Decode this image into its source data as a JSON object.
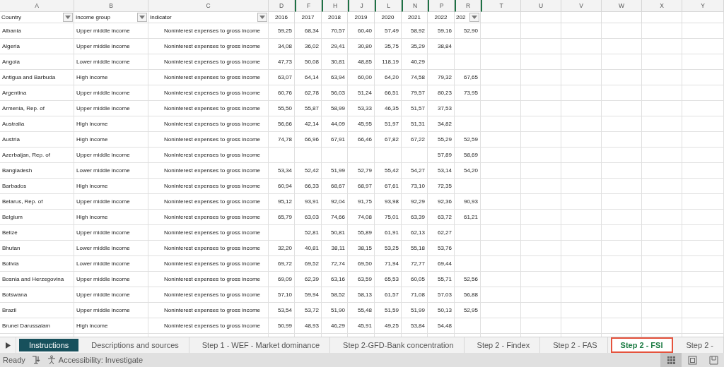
{
  "columns": [
    {
      "letter": "A",
      "hidden_before": false
    },
    {
      "letter": "B",
      "hidden_before": false
    },
    {
      "letter": "C",
      "hidden_before": false
    },
    {
      "letter": "D",
      "hidden_before": false
    },
    {
      "letter": "F",
      "hidden_before": true
    },
    {
      "letter": "H",
      "hidden_before": true
    },
    {
      "letter": "J",
      "hidden_before": true
    },
    {
      "letter": "L",
      "hidden_before": true
    },
    {
      "letter": "N",
      "hidden_before": true
    },
    {
      "letter": "P",
      "hidden_before": true
    },
    {
      "letter": "R",
      "hidden_before": true
    },
    {
      "letter": "T",
      "hidden_before": true
    },
    {
      "letter": "U",
      "hidden_before": false
    },
    {
      "letter": "V",
      "hidden_before": false
    },
    {
      "letter": "W",
      "hidden_before": false
    },
    {
      "letter": "X",
      "hidden_before": false
    },
    {
      "letter": "Y",
      "hidden_before": false
    }
  ],
  "header_row": [
    {
      "text": "Country",
      "filter": true
    },
    {
      "text": "Income group",
      "filter": true
    },
    {
      "text": "Indicator",
      "filter": true
    },
    {
      "text": "2016",
      "filter": false
    },
    {
      "text": "2017",
      "filter": false
    },
    {
      "text": "2018",
      "filter": false
    },
    {
      "text": "2019",
      "filter": false
    },
    {
      "text": "2020",
      "filter": false
    },
    {
      "text": "2021",
      "filter": false
    },
    {
      "text": "2022",
      "filter": false
    },
    {
      "text": "202",
      "filter": true
    }
  ],
  "rows": [
    {
      "country": "Albania",
      "income_group": "Upper middle income",
      "indicator": "Noninterest expenses to gross income",
      "values": {
        "d": "59,25",
        "f": "68,34",
        "h": "70,57",
        "j": "60,40",
        "l": "57,49",
        "n": "58,92",
        "p": "59,16",
        "r": "52,90"
      }
    },
    {
      "country": "Algeria",
      "income_group": "Upper middle income",
      "indicator": "Noninterest expenses to gross income",
      "values": {
        "d": "34,08",
        "f": "36,02",
        "h": "29,41",
        "j": "30,80",
        "l": "35,75",
        "n": "35,29",
        "p": "38,84"
      }
    },
    {
      "country": "Angola",
      "income_group": "Lower middle income",
      "indicator": "Noninterest expenses to gross income",
      "values": {
        "d": "47,73",
        "f": "50,08",
        "h": "30,81",
        "j": "48,85",
        "l": "118,19",
        "n": "40,29"
      }
    },
    {
      "country": "Antigua and Barbuda",
      "income_group": "High income",
      "indicator": "Noninterest expenses to gross income",
      "values": {
        "d": "63,07",
        "f": "64,14",
        "h": "63,94",
        "j": "60,00",
        "l": "64,20",
        "n": "74,58",
        "p": "79,32",
        "r": "67,65"
      }
    },
    {
      "country": "Argentina",
      "income_group": "Upper middle income",
      "indicator": "Noninterest expenses to gross income",
      "values": {
        "d": "60,76",
        "f": "62,78",
        "h": "56,03",
        "j": "51,24",
        "l": "66,51",
        "n": "79,57",
        "p": "80,23",
        "r": "73,95"
      }
    },
    {
      "country": "Armenia, Rep. of",
      "income_group": "Upper middle income",
      "indicator": "Noninterest expenses to gross income",
      "values": {
        "d": "55,50",
        "f": "55,87",
        "h": "58,99",
        "j": "53,33",
        "l": "46,35",
        "n": "51,57",
        "p": "37,53"
      }
    },
    {
      "country": "Australia",
      "income_group": "High income",
      "indicator": "Noninterest expenses to gross income",
      "values": {
        "d": "56,66",
        "f": "42,14",
        "h": "44,09",
        "j": "45,95",
        "l": "51,97",
        "n": "51,31",
        "p": "34,82"
      }
    },
    {
      "country": "Austria",
      "income_group": "High income",
      "indicator": "Noninterest expenses to gross income",
      "values": {
        "d": "74,78",
        "f": "66,96",
        "h": "67,91",
        "j": "66,46",
        "l": "67,82",
        "n": "67,22",
        "p": "55,29",
        "r": "52,59"
      }
    },
    {
      "country": "Azerbaijan, Rep. of",
      "income_group": "Upper middle income",
      "indicator": "Noninterest expenses to gross income",
      "values": {
        "p": "57,89",
        "r": "58,69"
      }
    },
    {
      "country": "Bangladesh",
      "income_group": "Lower middle income",
      "indicator": "Noninterest expenses to gross income",
      "values": {
        "d": "53,34",
        "f": "52,42",
        "h": "51,99",
        "j": "52,79",
        "l": "55,42",
        "n": "54,27",
        "p": "53,14",
        "r": "54,20"
      }
    },
    {
      "country": "Barbados",
      "income_group": "High income",
      "indicator": "Noninterest expenses to gross income",
      "values": {
        "d": "60,94",
        "f": "66,33",
        "h": "68,67",
        "j": "68,97",
        "l": "67,61",
        "n": "73,10",
        "p": "72,35"
      }
    },
    {
      "country": "Belarus, Rep. of",
      "income_group": "Upper middle income",
      "indicator": "Noninterest expenses to gross income",
      "values": {
        "d": "95,12",
        "f": "93,91",
        "h": "92,04",
        "j": "91,75",
        "l": "93,98",
        "n": "92,29",
        "p": "92,36",
        "r": "90,93"
      }
    },
    {
      "country": "Belgium",
      "income_group": "High income",
      "indicator": "Noninterest expenses to gross income",
      "values": {
        "d": "65,79",
        "f": "63,03",
        "h": "74,66",
        "j": "74,08",
        "l": "75,01",
        "n": "63,39",
        "p": "63,72",
        "r": "61,21"
      }
    },
    {
      "country": "Belize",
      "income_group": "Upper middle income",
      "indicator": "Noninterest expenses to gross income",
      "values": {
        "f": "52,81",
        "h": "50,81",
        "j": "55,89",
        "l": "61,91",
        "n": "62,13",
        "p": "62,27"
      }
    },
    {
      "country": "Bhutan",
      "income_group": "Lower middle income",
      "indicator": "Noninterest expenses to gross income",
      "values": {
        "d": "32,20",
        "f": "40,81",
        "h": "38,11",
        "j": "38,15",
        "l": "53,25",
        "n": "55,18",
        "p": "53,76"
      }
    },
    {
      "country": "Bolivia",
      "income_group": "Lower middle income",
      "indicator": "Noninterest expenses to gross income",
      "values": {
        "d": "69,72",
        "f": "69,52",
        "h": "72,74",
        "j": "69,50",
        "l": "71,94",
        "n": "72,77",
        "p": "69,44"
      }
    },
    {
      "country": "Bosnia and Herzegovina",
      "income_group": "Upper middle income",
      "indicator": "Noninterest expenses to gross income",
      "values": {
        "d": "69,09",
        "f": "62,39",
        "h": "63,16",
        "j": "63,59",
        "l": "65,53",
        "n": "60,05",
        "p": "55,71",
        "r": "52,56"
      }
    },
    {
      "country": "Botswana",
      "income_group": "Upper middle income",
      "indicator": "Noninterest expenses to gross income",
      "values": {
        "d": "57,10",
        "f": "59,94",
        "h": "58,52",
        "j": "58,13",
        "l": "61,57",
        "n": "71,08",
        "p": "57,03",
        "r": "56,88"
      }
    },
    {
      "country": "Brazil",
      "income_group": "Upper middle income",
      "indicator": "Noninterest expenses to gross income",
      "values": {
        "d": "53,54",
        "f": "53,72",
        "h": "51,90",
        "j": "55,48",
        "l": "51,59",
        "n": "51,99",
        "p": "50,13",
        "r": "52,95"
      }
    },
    {
      "country": "Brunei Darussalam",
      "income_group": "High income",
      "indicator": "Noninterest expenses to gross income",
      "values": {
        "d": "50,99",
        "f": "48,93",
        "h": "46,29",
        "j": "45,91",
        "l": "49,25",
        "n": "53,84",
        "p": "54,48"
      }
    }
  ],
  "sheet_tabs": [
    {
      "label": "Instructions",
      "selected": false,
      "highlighted": false,
      "color": "#17505c"
    },
    {
      "label": "Descriptions and sources",
      "selected": false,
      "highlighted": false
    },
    {
      "label": "Step 1 - WEF - Market dominance",
      "selected": false,
      "highlighted": false
    },
    {
      "label": "Step 2-GFD-Bank concentration",
      "selected": false,
      "highlighted": false
    },
    {
      "label": "Step 2 - Findex",
      "selected": false,
      "highlighted": false
    },
    {
      "label": "Step 2 - FAS",
      "selected": false,
      "highlighted": false
    },
    {
      "label": "Step 2 - FSI",
      "selected": true,
      "highlighted": true
    },
    {
      "label": "Step 2 -",
      "selected": false,
      "highlighted": false
    }
  ],
  "status_bar": {
    "status": "Ready",
    "accessibility": "Accessibility: Investigate",
    "views": [
      {
        "kind": "normal",
        "selected": true
      },
      {
        "kind": "page_layout",
        "selected": false
      },
      {
        "kind": "page_break",
        "selected": false
      }
    ]
  }
}
